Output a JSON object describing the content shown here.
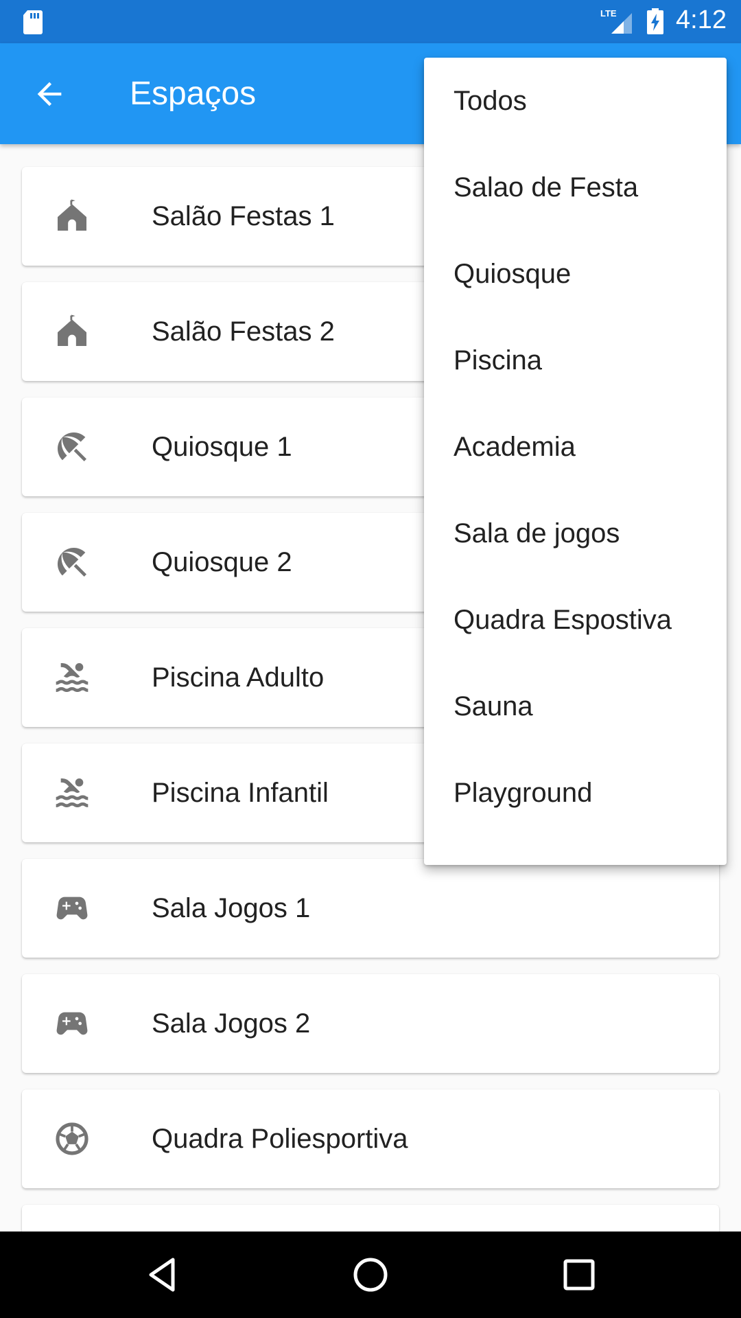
{
  "status_bar": {
    "time": "4:12",
    "network": "LTE",
    "icons": [
      "sd-card-icon",
      "lte-signal-icon",
      "battery-charging-icon"
    ]
  },
  "app_bar": {
    "title": "Espaços",
    "back_icon": "arrow-back-icon"
  },
  "spaces": [
    {
      "label": "Salão Festas 1",
      "icon": "house-icon"
    },
    {
      "label": "Salão Festas 2",
      "icon": "house-icon"
    },
    {
      "label": "Quiosque 1",
      "icon": "beach-umbrella-icon"
    },
    {
      "label": "Quiosque 2",
      "icon": "beach-umbrella-icon"
    },
    {
      "label": "Piscina Adulto",
      "icon": "pool-icon"
    },
    {
      "label": "Piscina Infantil",
      "icon": "pool-icon"
    },
    {
      "label": "Sala Jogos 1",
      "icon": "gamepad-icon"
    },
    {
      "label": "Sala Jogos 2",
      "icon": "gamepad-icon"
    },
    {
      "label": "Quadra Poliesportiva",
      "icon": "soccer-ball-icon"
    }
  ],
  "filter_menu": {
    "items": [
      "Todos",
      "Salao de Festa",
      "Quiosque",
      "Piscina",
      "Academia",
      "Sala de jogos",
      "Quadra Espostiva",
      "Sauna",
      "Playground"
    ]
  },
  "nav_bar": {
    "buttons": [
      "back-triangle-icon",
      "home-circle-icon",
      "recents-square-icon"
    ]
  },
  "colors": {
    "status_bar": "#1976d2",
    "app_bar": "#2196f3",
    "icon_gray": "#757575",
    "text": "#212121",
    "background": "#fafafa"
  }
}
